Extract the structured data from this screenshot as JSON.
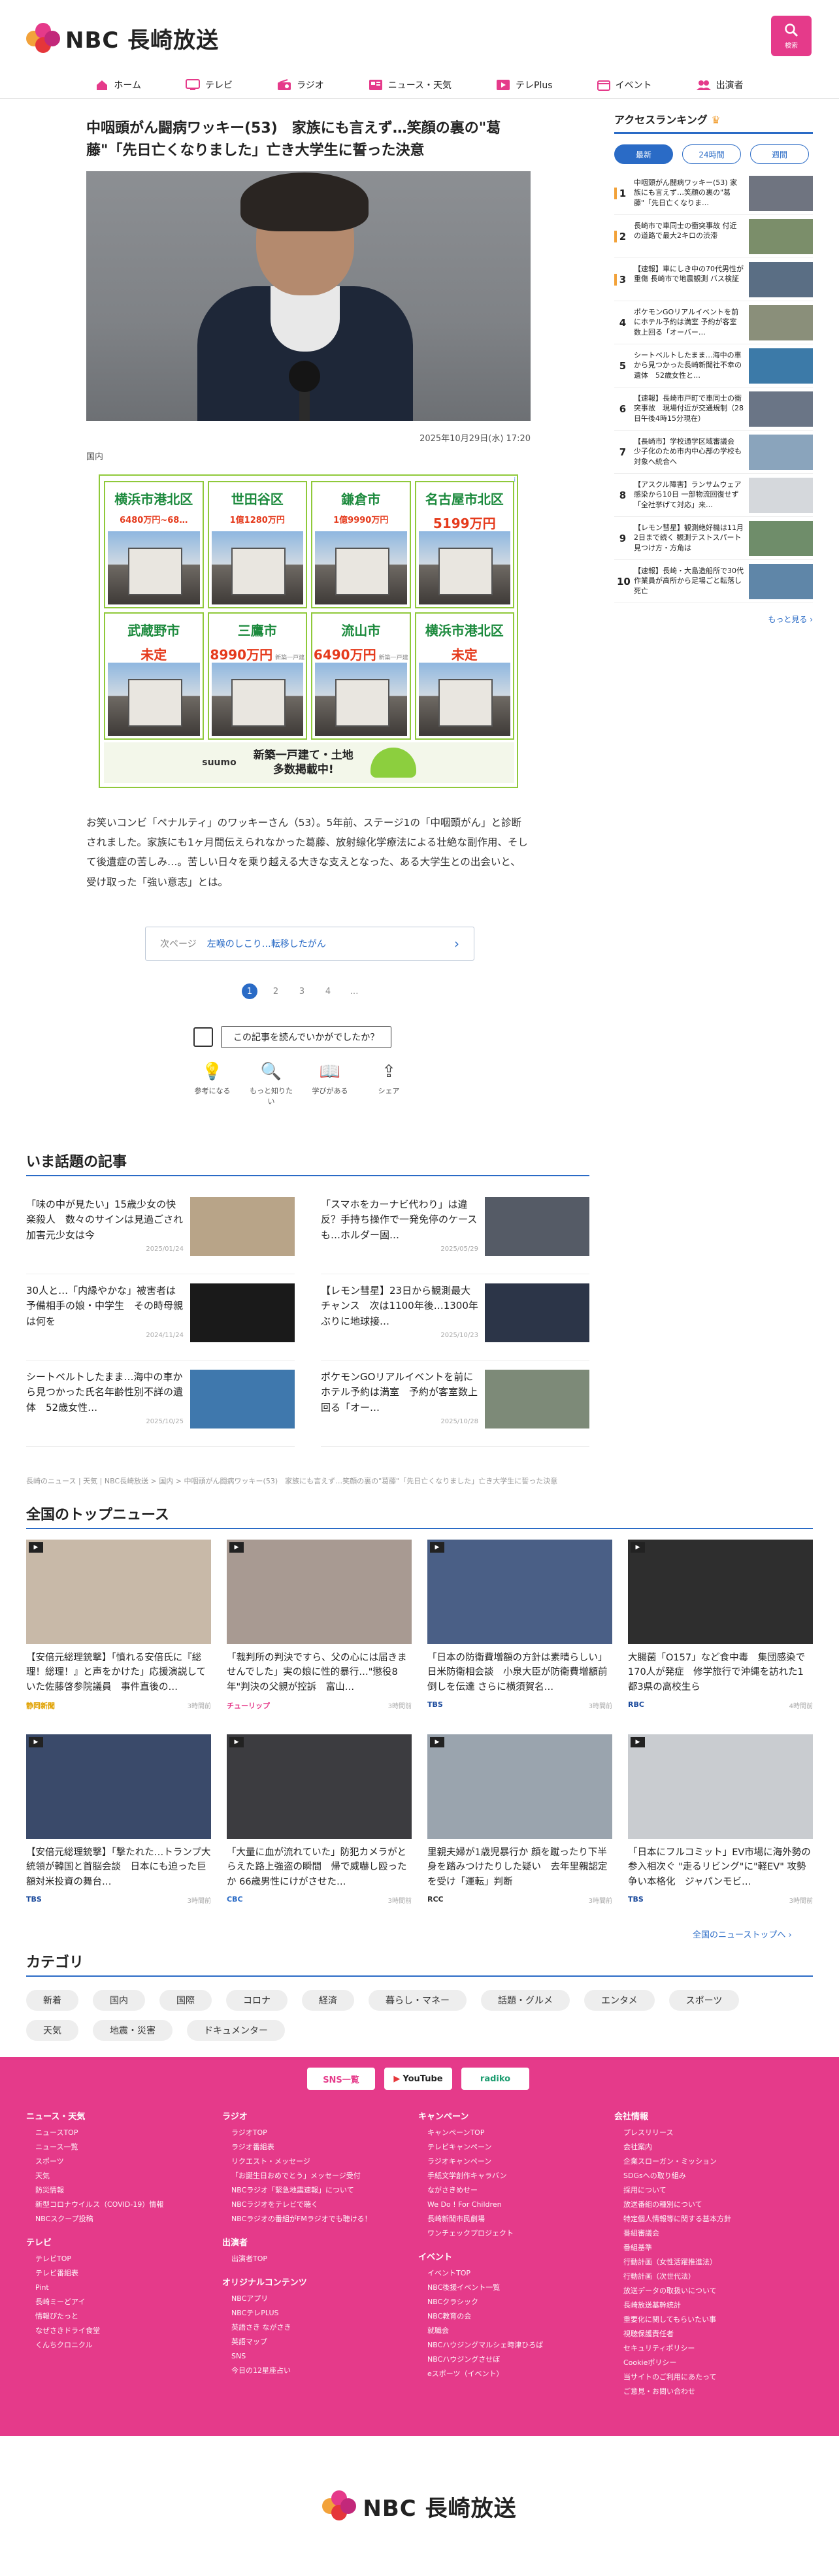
{
  "site": {
    "logo_text": "NBC 長崎放送",
    "search_label": "検索"
  },
  "nav": [
    {
      "label": "ホーム",
      "icon": "home-icon"
    },
    {
      "label": "テレビ",
      "icon": "tv-icon"
    },
    {
      "label": "ラジオ",
      "icon": "radio-icon"
    },
    {
      "label": "ニュース・天気",
      "icon": "news-icon"
    },
    {
      "label": "テレPlus",
      "icon": "play-icon"
    },
    {
      "label": "イベント",
      "icon": "calendar-icon"
    },
    {
      "label": "出演者",
      "icon": "people-icon"
    }
  ],
  "article": {
    "title": "中咽頭がん闘病ワッキー(53)　家族にも言えず…笑顔の裏の\"葛藤\"「先日亡くなりました」亡き大学生に誓った決意",
    "date": "2025年10月29日(水) 17:20",
    "category": "国内",
    "body": "お笑いコンビ「ペナルティ」のワッキーさん（53）。5年前、ステージ1の「中咽頭がん」と診断されました。家族にも1ヶ月間伝えられなかった葛藤、放射線化学療法による壮絶な副作用、そして後遺症の苦しみ…。苦しい日々を乗り越える大きな支えとなった、ある大学生との出会いと、受け取った「強い意志」とは。",
    "next_label": "次ページ",
    "next_title": "左喉のしこり…転移したがん",
    "pages": [
      "1",
      "2",
      "3",
      "4",
      "…"
    ],
    "reaction_question": "この記事を読んでいかがでしたか？",
    "reactions": [
      "参考になる",
      "もっと知りたい",
      "学びがある",
      "シェア"
    ]
  },
  "ad": {
    "badge": "i",
    "cards": [
      {
        "city": "横浜市港北区",
        "price": "6480万円~68…",
        "tag": ""
      },
      {
        "city": "世田谷区",
        "price": "1億1280万円",
        "tag": ""
      },
      {
        "city": "鎌倉市",
        "price": "1億9990万円",
        "tag": ""
      },
      {
        "city": "名古屋市北区",
        "price": "5199万円",
        "tag": ""
      },
      {
        "city": "武蔵野市",
        "price": "未定",
        "tag": ""
      },
      {
        "city": "三鷹市",
        "price": "8990万円",
        "tag": "新築一戸建"
      },
      {
        "city": "流山市",
        "price": "6490万円",
        "tag": "新築一戸建"
      },
      {
        "city": "横浜市港北区",
        "price": "未定",
        "tag": ""
      }
    ],
    "brand": "suumo",
    "footer_line1": "新築一戸建て・土地",
    "footer_line2": "多数掲載中!"
  },
  "ranking": {
    "title": "アクセスランキング",
    "tabs": [
      "最新",
      "24時間",
      "週間"
    ],
    "items": [
      {
        "num": "1",
        "text": "中咽頭がん闘病ワッキー(53) 家族にも言えず…笑顔の裏の\"葛藤\"「先日亡くなりま…"
      },
      {
        "num": "2",
        "text": "長崎市で車同士の衝突事故 付近の道路で最大2キロの渋滞"
      },
      {
        "num": "3",
        "text": "【速報】車にしき中の70代男性が重傷 長崎市で地震観測 バス検証"
      },
      {
        "num": "4",
        "text": "ポケモンGOリアルイベントを前にホテル予約は満室 予約が客室数上回る「オーバー…"
      },
      {
        "num": "5",
        "text": "シートベルトしたまま…海中の車から見つかった長崎新聞社不幸の遺体　52歳女性と…"
      },
      {
        "num": "6",
        "text": "【速報】長崎市戸町で車同士の衝突事故　現場付近が交通規制（28日午後4時15分現在）"
      },
      {
        "num": "7",
        "text": "【長崎市】学校通学区域審議会 少子化のため市内中心部の学校も対象へ統合へ"
      },
      {
        "num": "8",
        "text": "【アスクル障害】ランサムウェア感染から10日 一部物流回復せず「全社挙げて対応」来…"
      },
      {
        "num": "9",
        "text": "【レモン彗星】観測絶好機は11月2日まで続く 観測テストスパート 見つけ方・方角は"
      },
      {
        "num": "10",
        "text": "【速報】長崎・大島造船所で30代作業員が高所から足場ごと転落し死亡"
      }
    ],
    "more": "もっと見る ›"
  },
  "trending": {
    "title": "いま話題の記事",
    "items": [
      {
        "text": "「味の中が見たい」15歳少女の快楽殺人　数々のサインは見過ごされ　加害元少女は今",
        "date": "2025/01/24"
      },
      {
        "text": "「スマホをカーナビ代わり」は違反？手持ち操作で一発免停のケースも…ホルダー固…",
        "date": "2025/05/29"
      },
      {
        "text": "30人と…「内縁やかな」被害者は予備相手の娘・中学生　その時母親は何を",
        "date": "2024/11/24"
      },
      {
        "text": "【レモン彗星】23日から観測最大チャンス　次は1100年後…1300年ぶりに地球接…",
        "date": "2025/10/23"
      },
      {
        "text": "シートベルトしたまま…海中の車から見つかった氏名年齢性別不詳の遺体　52歳女性…",
        "date": "2025/10/25"
      },
      {
        "text": "ポケモンGOリアルイベントを前にホテル予約は満室　予約が客室数上回る「オー…",
        "date": "2025/10/28"
      }
    ]
  },
  "breadcrumb": "長崎のニュース | 天気 | NBC長崎放送 > 国内 > 中咽頭がん闘病ワッキー(53)　家族にも言えず…笑顔の裏の\"葛藤\"「先日亡くなりました」亡き大学生に誓った決意",
  "topnews": {
    "title": "全国のトップニュース",
    "items": [
      {
        "text": "【安倍元総理銃撃】「憤れる安倍氏に『総理！総理！』と声をかけた」応援演説していた佐藤啓参院議員　事件直後の…",
        "source": "静岡新聞",
        "time": "3時間前",
        "src_color": "#e0a100"
      },
      {
        "text": "「裁判所の判決ですら、父の心には届きませんでした」実の娘に性的暴行…\"懲役8年\"判決の父親が控訴　富山…",
        "source": "チューリップ",
        "time": "3時間前",
        "src_color": "#e53a8a"
      },
      {
        "text": "「日本の防衛費増額の方針は素晴らしい」日米防衛相会談　小泉大臣が防衛費増額前倒しを伝達 さらに横須賀名…",
        "source": "TBS",
        "time": "3時間前",
        "src_color": "#1b4a9c"
      },
      {
        "text": "大腸菌「O157」など食中毒　集団感染で170人が発症　修学旅行で沖縄を訪れた1都3県の高校生ら",
        "source": "RBC",
        "time": "4時間前",
        "src_color": "#1b4a9c"
      },
      {
        "text": "【安倍元総理銃撃】「撃たれた…トランプ大統領が韓国と首脳会談　日本にも迫った巨額対米投資の舞台…",
        "source": "TBS",
        "time": "3時間前",
        "src_color": "#1b4a9c"
      },
      {
        "text": "「大量に血が流れていた」防犯カメラがとらえた路上強盗の瞬間　帰で威嚇し殴ったか 66歳男性にけがさせた…",
        "source": "CBC",
        "time": "3時間前",
        "src_color": "#2a6bc6"
      },
      {
        "text": "里親夫婦が1歳児暴行か 顔を蹴ったり下半身を踏みつけたりした疑い　去年里親認定を受け「運転」判断",
        "source": "RCC",
        "time": "3時間前",
        "src_color": "#333333"
      },
      {
        "text": "「日本にフルコミット」EV市場に海外勢の参入相次ぐ \"走るリビング\"に\"軽EV\" 攻勢争い本格化　ジャパンモビ…",
        "source": "TBS",
        "time": "3時間前",
        "src_color": "#1b4a9c"
      }
    ],
    "more": "全国のニューストップへ ›"
  },
  "category": {
    "title": "カテゴリ",
    "items": [
      "新着",
      "国内",
      "国際",
      "コロナ",
      "経済",
      "暮らし・マネー",
      "話題・グルメ",
      "エンタメ",
      "スポーツ",
      "天気",
      "地震・災害",
      "ドキュメンター"
    ]
  },
  "footer": {
    "social": [
      "SNS一覧",
      "YouTube",
      "radiko"
    ],
    "columns": [
      {
        "head": "ニュース・天気",
        "links": [
          "ニュースTOP",
          "ニュース一覧",
          "スポーツ",
          "天気",
          "防災情報",
          "新型コロナウイルス（COVID-19）情報",
          "NBCスクープ投稿"
        ],
        "sub": "テレビ",
        "sub_links": [
          "テレビTOP",
          "テレビ番組表",
          "Pint",
          "長崎ミーどアイ",
          "情報ぴたっと",
          "なぜさきドライ食堂",
          "くんちクロニクル"
        ]
      },
      {
        "head": "ラジオ",
        "links": [
          "ラジオTOP",
          "ラジオ番組表",
          "リクエスト・メッセージ",
          "「お誕生日おめでとう」メッセージ受付",
          "NBCラジオ「緊急地震速報」について",
          "NBCラジオをテレビで聴く",
          "NBCラジオの番組がFMラジオでも聴ける！"
        ],
        "sub": "出演者",
        "sub_links": [
          "出演者TOP"
        ],
        "sub2": "オリジナルコンテンツ",
        "sub2_links": [
          "NBCアプリ",
          "NBCテレPLUS",
          "英語さき ながさき",
          "英語マップ",
          "SNS",
          "今日の12星座占い"
        ]
      },
      {
        "head": "キャンペーン",
        "links": [
          "キャンペーンTOP",
          "テレビキャンペーン",
          "ラジオキャンペーン",
          "手紙文学創作キャラバン",
          "ながさきめせー",
          "We Do ! For Children",
          "長崎新聞市民劇場",
          "ワンチェックプロジェクト"
        ],
        "sub": "イベント",
        "sub_links": [
          "イベントTOP",
          "NBC後援イベント一覧",
          "NBCクラシック",
          "NBC教育の会",
          "就職会",
          "NBCハウジングマルシェ時津ひろば",
          "NBCハウジングさせぼ",
          "eスポーツ（イベント）"
        ]
      },
      {
        "head": "会社情報",
        "links": [
          "プレスリリース",
          "会社案内",
          "企業スローガン・ミッション",
          "SDGsへの取り組み",
          "採用について",
          "放送番組の種別について",
          "特定個人情報等に関する基本方針",
          "番組審議会",
          "番組基準",
          "行動計画（女性活躍推進法）",
          "行動計画（次世代法）",
          "放送データの取扱いについて",
          "長崎放送基幹統計",
          "重要化に関してもらいたい事",
          "視聴保護責任者",
          "セキュリティポリシー",
          "Cookieポリシー",
          "当サイトのご利用にあたって",
          "ご意見・お問い合わせ"
        ]
      }
    ]
  },
  "colors": {
    "brand_pink": "#e53a8a",
    "accent_blue": "#2a6bc6"
  }
}
